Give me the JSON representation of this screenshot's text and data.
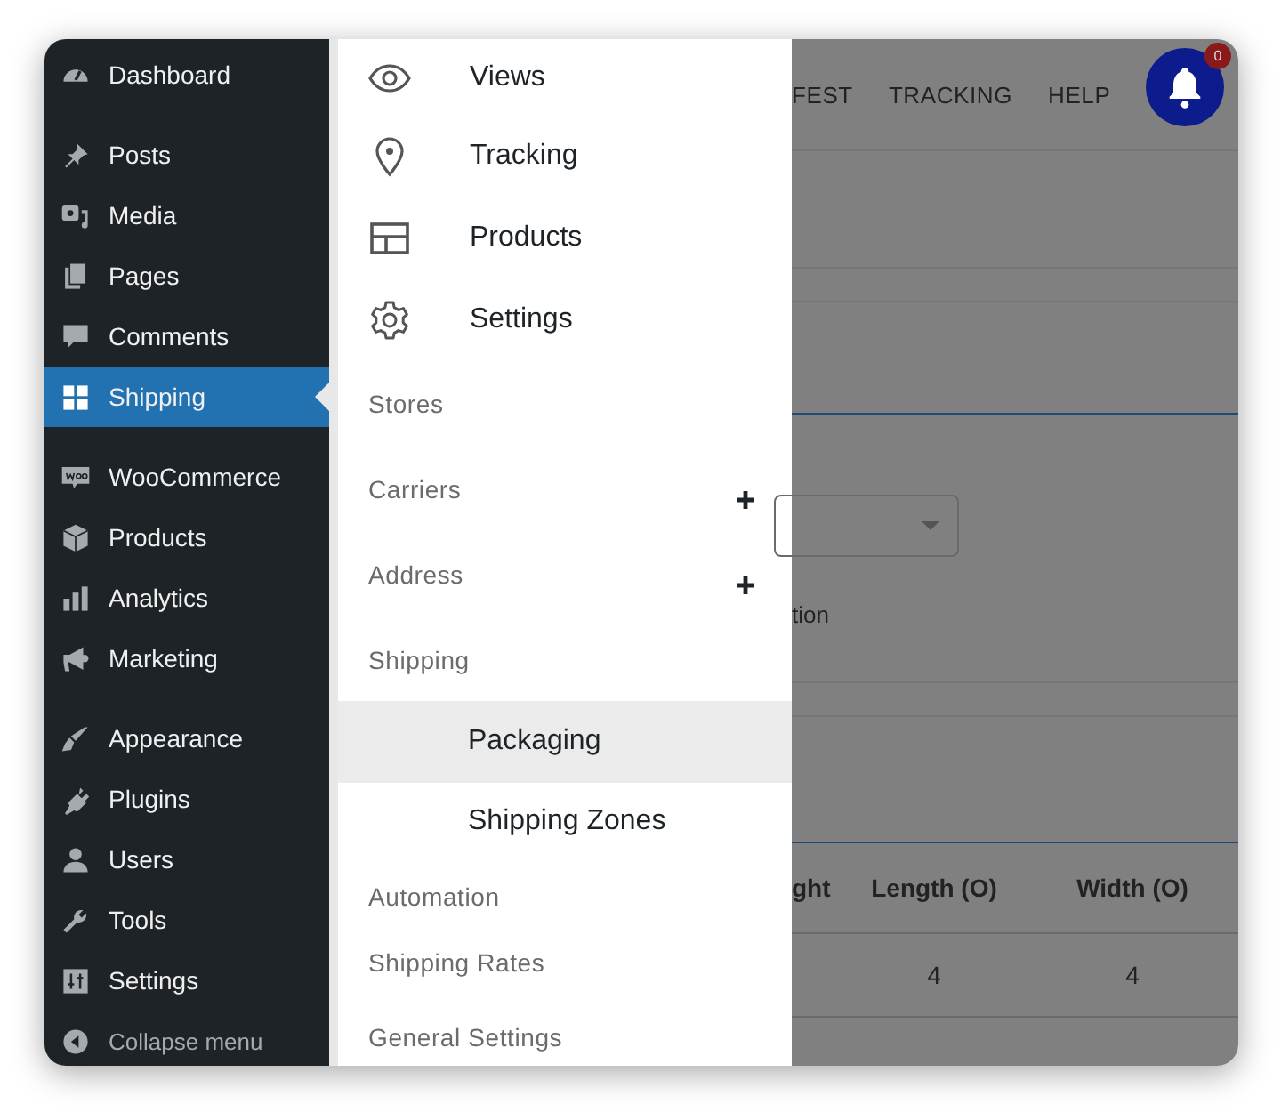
{
  "sidebar": {
    "groups": [
      [
        {
          "label": "Dashboard",
          "selected": false
        }
      ],
      [
        {
          "label": "Posts",
          "selected": false
        },
        {
          "label": "Media",
          "selected": false
        },
        {
          "label": "Pages",
          "selected": false
        },
        {
          "label": "Comments",
          "selected": false
        },
        {
          "label": "Shipping",
          "selected": true
        }
      ],
      [
        {
          "label": "WooCommerce",
          "selected": false
        },
        {
          "label": "Products",
          "selected": false
        },
        {
          "label": "Analytics",
          "selected": false
        },
        {
          "label": "Marketing",
          "selected": false
        }
      ],
      [
        {
          "label": "Appearance",
          "selected": false
        },
        {
          "label": "Plugins",
          "selected": false
        },
        {
          "label": "Users",
          "selected": false
        },
        {
          "label": "Tools",
          "selected": false
        },
        {
          "label": "Settings",
          "selected": false
        }
      ]
    ],
    "collapse": "Collapse menu"
  },
  "submenu": [
    {
      "kind": "icon_item",
      "label": "Views"
    },
    {
      "kind": "icon_item",
      "label": "Tracking"
    },
    {
      "kind": "icon_item",
      "label": "Products"
    },
    {
      "kind": "icon_item",
      "label": "Settings"
    },
    {
      "kind": "section",
      "label": "Stores",
      "expandable": false
    },
    {
      "kind": "section",
      "label": "Carriers",
      "expandable": true
    },
    {
      "kind": "section",
      "label": "Address",
      "expandable": true
    },
    {
      "kind": "section",
      "label": "Shipping",
      "expandable": false
    },
    {
      "kind": "sub_item",
      "label": "Packaging",
      "selected": true
    },
    {
      "kind": "sub_item",
      "label": "Shipping Zones",
      "selected": false
    },
    {
      "kind": "section",
      "label": "Automation",
      "expandable": false
    },
    {
      "kind": "section",
      "label": "Shipping Rates",
      "expandable": false
    },
    {
      "kind": "section",
      "label": "General Settings",
      "expandable": false
    }
  ],
  "background": {
    "nav": [
      "FEST",
      "TRACKING",
      "HELP"
    ],
    "notification_count": "0",
    "option_text": "tion",
    "table": {
      "columns": [
        "ght",
        "Length (O)",
        "Width (O)"
      ],
      "rows": [
        [
          "",
          "4",
          "4"
        ]
      ]
    }
  }
}
